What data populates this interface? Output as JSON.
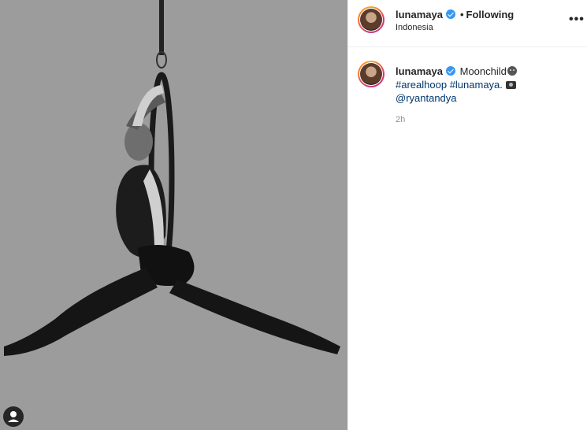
{
  "header": {
    "username": "lunamaya",
    "separator": "•",
    "follow_status": "Following",
    "location": "Indonesia",
    "more_label": "•••"
  },
  "caption": {
    "username": "lunamaya",
    "text": "Moonchild",
    "hashtag1": "#arealhoop",
    "hashtag2": "#lunamaya.",
    "mention": "@ryantandya"
  },
  "timestamp": "2h",
  "colors": {
    "verified": "#3897f0",
    "link": "#00376b",
    "photo_background": "#9c9c9c"
  },
  "icons": [
    "verified-badge-icon",
    "more-options-icon",
    "user-tag-icon",
    "face-emoji-icon",
    "camera-emoji-icon"
  ]
}
